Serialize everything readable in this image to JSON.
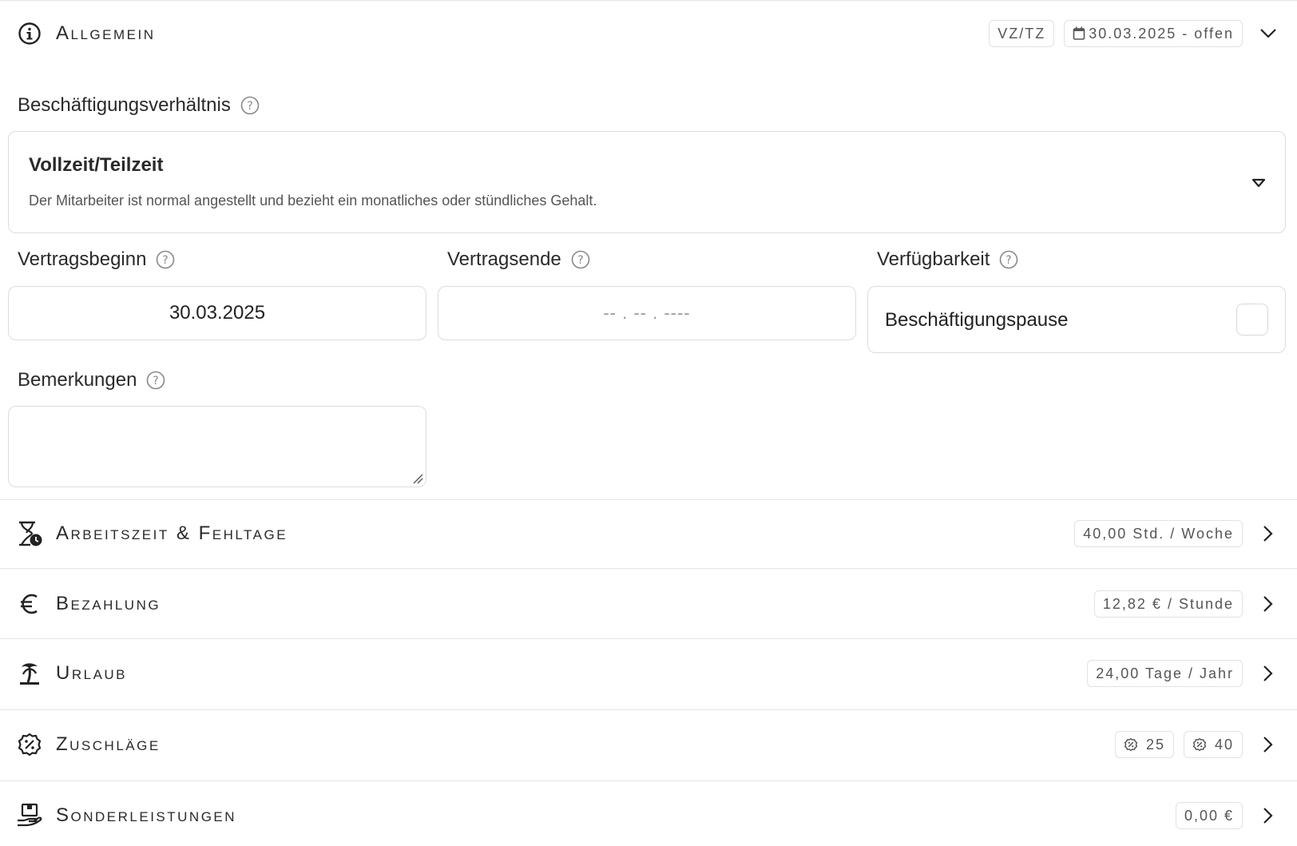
{
  "sections": {
    "allgemein": {
      "title": "Allgemein",
      "icon": "info-circle-icon",
      "badge_type": "VZ/TZ",
      "badge_date": "30.03.2025 - offen",
      "expanded": true
    },
    "arbeitszeit": {
      "title": "Arbeitszeit & Fehltage",
      "icon": "hourglass-clock-icon",
      "badge": "40,00 Std. / Woche"
    },
    "bezahlung": {
      "title": "Bezahlung",
      "icon": "euro-icon",
      "badge": "12,82 € / Stunde"
    },
    "urlaub": {
      "title": "Urlaub",
      "icon": "palm-tree-icon",
      "badge": "24,00 Tage / Jahr"
    },
    "zuschlaege": {
      "title": "Zuschläge",
      "icon": "percent-badge-icon",
      "badge1": "25",
      "badge2": "40"
    },
    "sonderleistungen": {
      "title": "Sonderleistungen",
      "icon": "hand-gift-icon",
      "badge": "0,00 €"
    }
  },
  "form": {
    "beschaeftigung": {
      "label": "Beschäftigungsverhältnis",
      "selected_title": "Vollzeit/Teilzeit",
      "selected_desc": "Der Mitarbeiter ist normal angestellt und bezieht ein monatliches oder stündliches Gehalt."
    },
    "vertragsbeginn": {
      "label": "Vertragsbeginn",
      "value": "30.03.2025"
    },
    "vertragsende": {
      "label": "Vertragsende",
      "placeholder": "-- . -- . ----"
    },
    "verfuegbarkeit": {
      "label": "Verfügbarkeit",
      "option": "Beschäftigungspause",
      "checked": false
    },
    "bemerkungen": {
      "label": "Bemerkungen",
      "value": ""
    }
  }
}
